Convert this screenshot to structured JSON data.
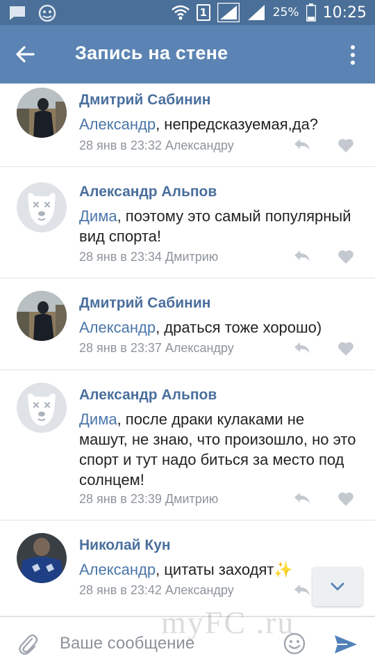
{
  "status_bar": {
    "sim_slot": "1",
    "battery": "25%",
    "time": "10:25"
  },
  "app_bar": {
    "title": "Запись на стене",
    "icons": [
      "back-arrow-icon",
      "more-vertical-icon"
    ]
  },
  "colors": {
    "status_bar": "#4a6f98",
    "app_bar": "#5b84b4",
    "author": "#4a6f9d",
    "mention": "#4a76a8",
    "meta": "#8e949c",
    "icon_grey": "#c4c9d0",
    "send": "#5181b8"
  },
  "comments": [
    {
      "author": "Дмитрий Сабинин",
      "avatar": "photo-avatar-dark",
      "mention": "Александр",
      "text": ", непредсказуемая,да?",
      "meta": "28 янв в 23:32 Александру"
    },
    {
      "author": "Александр Альпов",
      "avatar": "deactivated-dog-avatar",
      "mention": "Дима",
      "text": ", поэтому это самый популярный вид спорта!",
      "meta": "28 янв в 23:34 Дмитрию"
    },
    {
      "author": "Дмитрий Сабинин",
      "avatar": "photo-avatar-dark",
      "mention": "Александр",
      "text": ", драться тоже хорошо)",
      "meta": "28 янв в 23:37 Александру"
    },
    {
      "author": "Александр Альпов",
      "avatar": "deactivated-dog-avatar",
      "mention": "Дима",
      "text": ", после драки кулаками не машут, не знаю, что произошло, но это спорт и тут надо биться за место под солнцем!",
      "meta": "28 янв в 23:39 Дмитрию"
    },
    {
      "author": "Николай Кун",
      "avatar": "photo-avatar-blue",
      "mention": "Александр",
      "text": ", цитаты заходят✨",
      "meta": "28 янв в 23:42 Александру"
    }
  ],
  "composer": {
    "placeholder": "Ваше сообщение"
  },
  "watermark": "myFC .ru"
}
